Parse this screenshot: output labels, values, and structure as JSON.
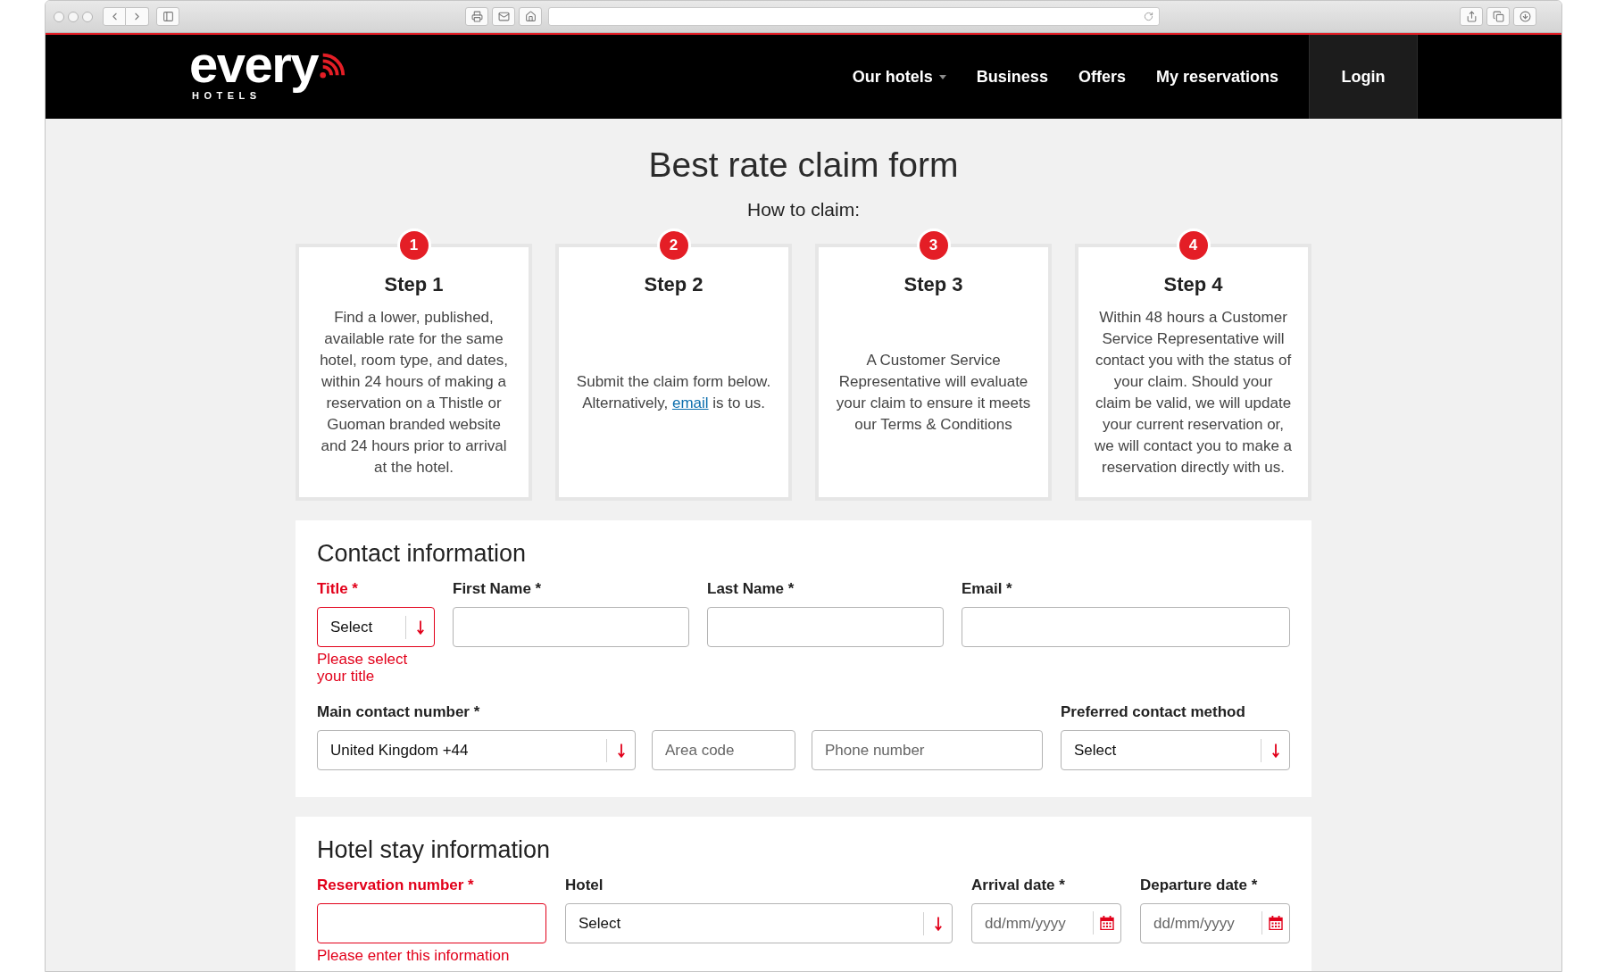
{
  "header": {
    "logo": {
      "wordmark": "every",
      "subtitle": "HOTELS"
    },
    "nav": [
      {
        "label": "Our hotels",
        "has_menu": true
      },
      {
        "label": "Business",
        "has_menu": false
      },
      {
        "label": "Offers",
        "has_menu": false
      },
      {
        "label": "My reservations",
        "has_menu": false
      }
    ],
    "login": "Login"
  },
  "page": {
    "title": "Best rate claim form",
    "subtitle": "How to claim:"
  },
  "steps": [
    {
      "number": "1",
      "title": "Step 1",
      "parts": [
        {
          "kind": "text",
          "text": "Find a lower, published, available rate for the same hotel, room type, and dates, within 24 hours of making a reservation on a Thistle or Guoman branded website and 24 hours prior to arrival at the hotel."
        }
      ]
    },
    {
      "number": "2",
      "title": "Step 2",
      "parts": [
        {
          "kind": "text",
          "text": "Submit the claim form below. Alternatively, "
        },
        {
          "kind": "link",
          "text": "email"
        },
        {
          "kind": "text",
          "text": " is to us."
        }
      ]
    },
    {
      "number": "3",
      "title": "Step 3",
      "parts": [
        {
          "kind": "text",
          "text": "A Customer Service Representative will evaluate your claim to ensure it meets our Terms & Conditions"
        }
      ]
    },
    {
      "number": "4",
      "title": "Step 4",
      "parts": [
        {
          "kind": "text",
          "text": "Within 48 hours a Customer Service Representative will contact you with the status of your claim. Should your claim be valid, we will update your current reservation or, we will contact you to make a reservation directly with us."
        }
      ]
    }
  ],
  "sections": [
    {
      "heading": "Contact information",
      "fields": [
        {
          "label": "Title *",
          "invalid": true,
          "error": "Please select your title",
          "controls": [
            {
              "kind": "select",
              "value": "Select"
            }
          ]
        },
        {
          "label": "First Name *",
          "invalid": false,
          "controls": [
            {
              "kind": "input"
            }
          ]
        },
        {
          "label": "Last Name *",
          "invalid": false,
          "controls": [
            {
              "kind": "input"
            }
          ]
        },
        {
          "label": "Email *",
          "invalid": false,
          "controls": [
            {
              "kind": "input"
            }
          ]
        },
        {
          "label": "Main contact number *",
          "invalid": false,
          "controls": [
            {
              "kind": "select",
              "value": "United Kingdom +44"
            },
            {
              "kind": "input",
              "placeholder": "Area code"
            },
            {
              "kind": "input",
              "placeholder": "Phone number"
            }
          ]
        },
        {
          "label": "Preferred contact method",
          "invalid": false,
          "controls": [
            {
              "kind": "select",
              "value": "Select"
            }
          ]
        }
      ]
    },
    {
      "heading": "Hotel stay information",
      "fields": [
        {
          "label": "Reservation number *",
          "invalid": true,
          "error": "Please enter this information",
          "controls": [
            {
              "kind": "input"
            }
          ]
        },
        {
          "label": "Hotel",
          "invalid": false,
          "controls": [
            {
              "kind": "select",
              "value": "Select"
            }
          ]
        },
        {
          "label": "Arrival date *",
          "invalid": false,
          "controls": [
            {
              "kind": "date",
              "placeholder": "dd/mm/yyyy"
            }
          ]
        },
        {
          "label": "Departure date *",
          "invalid": false,
          "controls": [
            {
              "kind": "date",
              "placeholder": "dd/mm/yyyy"
            }
          ]
        }
      ]
    }
  ]
}
